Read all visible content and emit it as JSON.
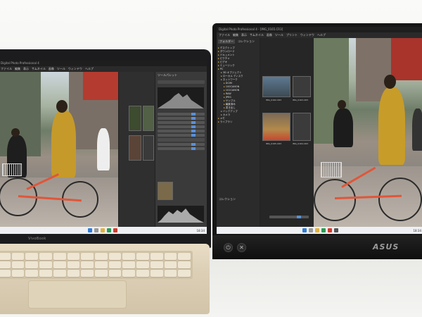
{
  "laptop": {
    "brand": "VivoBook",
    "screen_title": "Digital Photo Professional 4",
    "menu": [
      "ファイル",
      "編集",
      "表示",
      "サムネイル",
      "画像",
      "ツール",
      "ウィンドウ",
      "ヘルプ"
    ],
    "panel_title": "ツールパレット",
    "clock": "18:34"
  },
  "monitor": {
    "brand": "ASUS",
    "menu": [
      "ファイル",
      "編集",
      "表示",
      "サムネイル",
      "画像",
      "ツール",
      "プリント",
      "ウィンドウ",
      "ヘルプ"
    ],
    "window_title": "Digital Photo Professional 4 - [IMG_0165.CR3]",
    "tabs": [
      "フォルダー",
      "コレクション"
    ],
    "folder_tree": [
      "デスクトップ",
      "ダウンロード",
      "ドキュメント",
      "ピクチャ",
      "ビデオ",
      "ミュージック",
      "PC",
      "3D オブジェクト",
      "ローカル ディスク",
      "ネットワーク",
      "DCIM",
      "100CANON",
      "101CANON",
      "RAW",
      "JPEG",
      "サンプル",
      "編集済み",
      "書き出し",
      "バックアップ",
      "カメラ",
      "メモ",
      "ライブラリ"
    ],
    "thumbs": [
      "IMG_0162.CR3",
      "IMG_0163.CR3",
      "IMG_0164.CR3",
      "IMG_0165.CR3"
    ],
    "collection_label": "コレクション",
    "clock": "18:34"
  },
  "colors": {
    "accent": "#5b8fd6",
    "bike": "#e0563a",
    "laptop_lid": "#1c1c1e",
    "laptop_base": "#dccfb6"
  }
}
